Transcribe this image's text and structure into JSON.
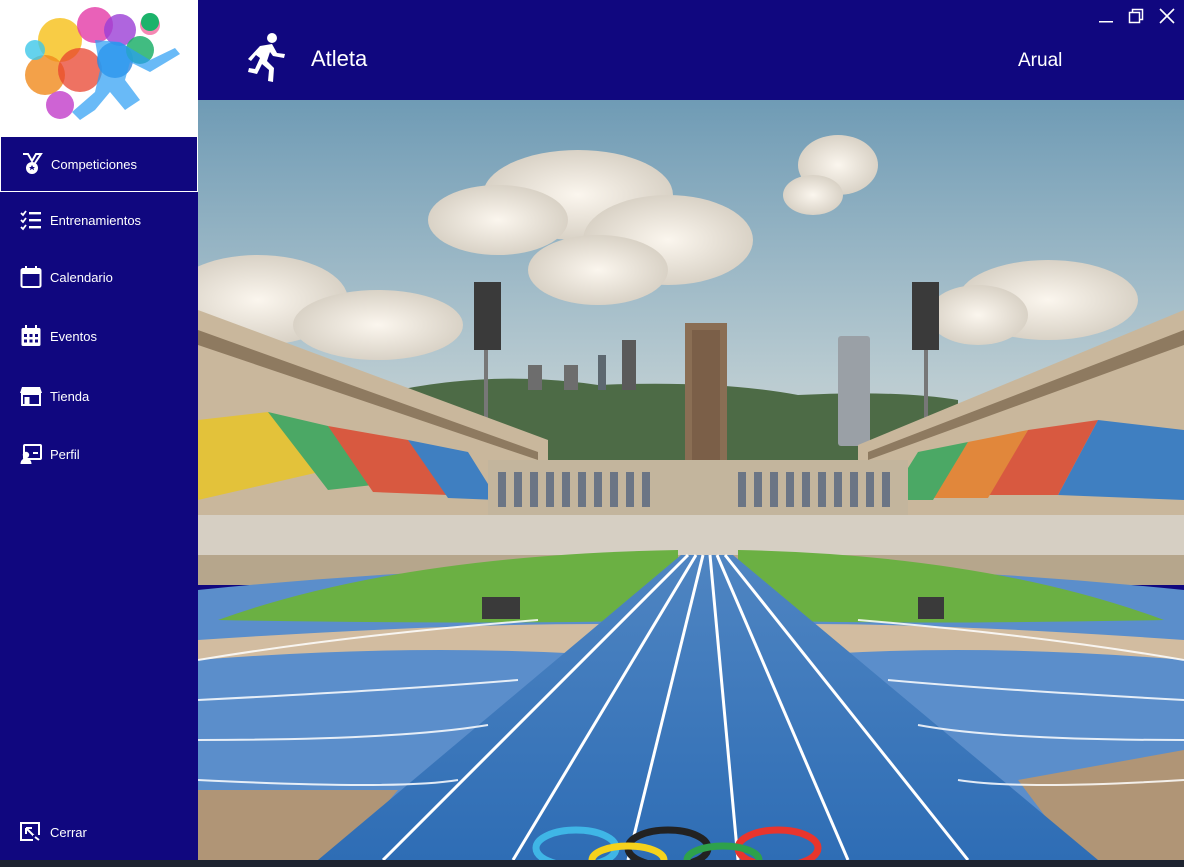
{
  "header": {
    "title": "Atleta",
    "user": "Arual"
  },
  "sidebar": {
    "items": [
      {
        "label": "Competiciones",
        "icon": "medal-icon",
        "active": true
      },
      {
        "label": "Entrenamientos",
        "icon": "checklist-icon"
      },
      {
        "label": "Calendario",
        "icon": "calendar-icon"
      },
      {
        "label": "Eventos",
        "icon": "calendar-grid-icon"
      },
      {
        "label": "Tienda",
        "icon": "store-icon"
      },
      {
        "label": "Perfil",
        "icon": "profile-icon"
      }
    ],
    "logout": {
      "label": "Cerrar",
      "icon": "logout-icon"
    }
  },
  "colors": {
    "primary": "#10077f",
    "text": "#ffffff"
  }
}
